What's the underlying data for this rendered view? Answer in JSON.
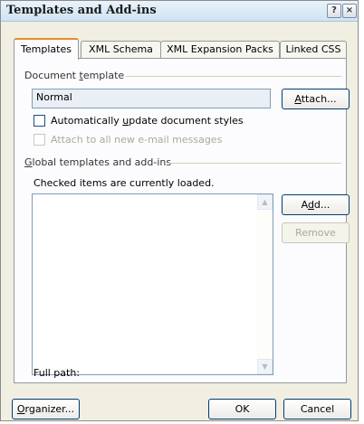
{
  "window": {
    "title": "Templates and Add-ins",
    "help_icon_label": "?",
    "close_icon_label": "×"
  },
  "tabs": [
    {
      "label": "Templates",
      "active": true
    },
    {
      "label": "XML Schema",
      "active": false
    },
    {
      "label": "XML Expansion Packs",
      "active": false
    },
    {
      "label": "Linked CSS",
      "active": false
    }
  ],
  "document_template": {
    "group_label_pre": "Document ",
    "group_label_u": "t",
    "group_label_post": "emplate",
    "value": "Normal",
    "attach_pre": "",
    "attach_u": "A",
    "attach_post": "ttach...",
    "auto_update_pre": "Automatically ",
    "auto_update_u": "u",
    "auto_update_post": "pdate document styles",
    "auto_update_checked": false,
    "attach_email_label": "Attach to all new e-mail messages",
    "attach_email_enabled": false
  },
  "global": {
    "group_label_pre": "",
    "group_label_u": "G",
    "group_label_post": "lobal templates and add-ins",
    "note": "Checked items are currently loaded.",
    "add_pre": "A",
    "add_u": "d",
    "add_post": "d...",
    "remove_label": "Remove",
    "items": []
  },
  "full_path_label": "Full path:",
  "footer": {
    "organizer_pre": "",
    "organizer_u": "O",
    "organizer_post": "rganizer...",
    "ok_label": "OK",
    "cancel_label": "Cancel"
  }
}
